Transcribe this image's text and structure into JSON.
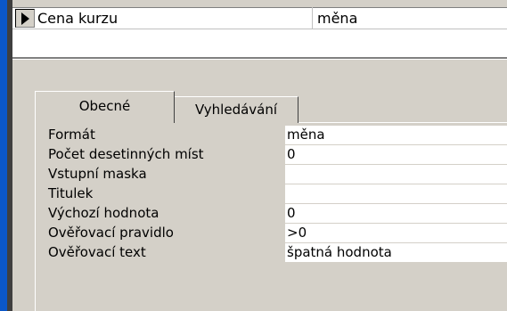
{
  "field_row": {
    "name": "Cena kurzu",
    "type": "měna"
  },
  "tabs": [
    {
      "label": "Obecné",
      "active": true
    },
    {
      "label": "Vyhledávání",
      "active": false
    }
  ],
  "properties": [
    {
      "label": "Formát",
      "value": "měna"
    },
    {
      "label": "Počet desetinných míst",
      "value": "0"
    },
    {
      "label": "Vstupní maska",
      "value": ""
    },
    {
      "label": "Titulek",
      "value": ""
    },
    {
      "label": "Výchozí hodnota",
      "value": "0"
    },
    {
      "label": "Ověřovací pravidlo",
      "value": ">0"
    },
    {
      "label": "Ověřovací text",
      "value": "špatná hodnota"
    }
  ]
}
